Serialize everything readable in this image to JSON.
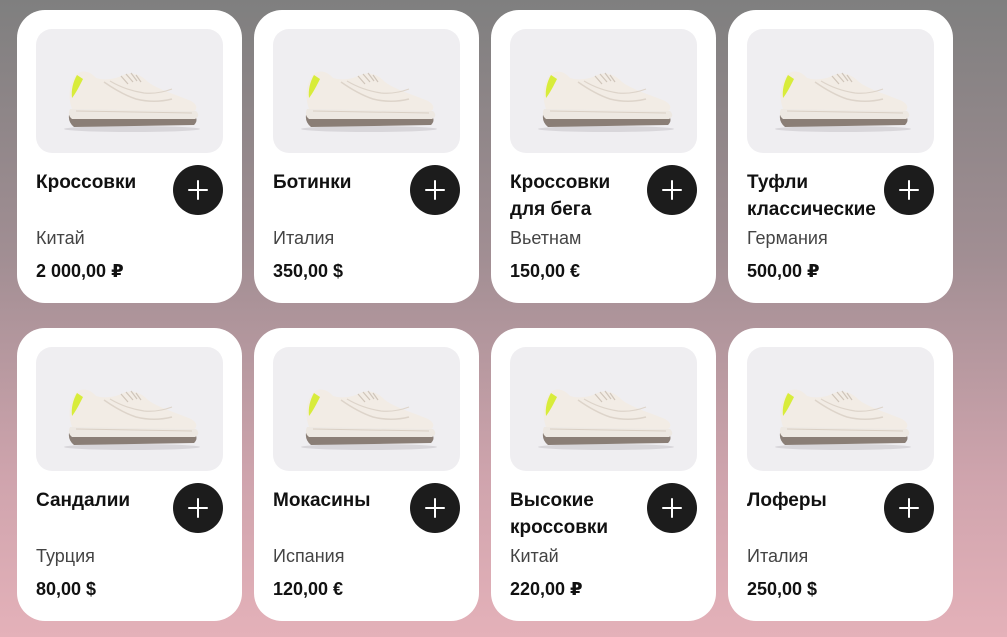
{
  "products": [
    {
      "name": "Кроссовки",
      "country": "Китай",
      "price": "2 000,00 ₽",
      "add_icon": "plus-icon"
    },
    {
      "name": "Ботинки",
      "country": "Италия",
      "price": "350,00 $",
      "add_icon": "plus-icon"
    },
    {
      "name": "Кроссовки для бега",
      "country": "Вьетнам",
      "price": "150,00 €",
      "add_icon": "plus-icon"
    },
    {
      "name": "Туфли классические",
      "country": "Германия",
      "price": "500,00 ₽",
      "add_icon": "plus-icon"
    },
    {
      "name": "Сандалии",
      "country": "Турция",
      "price": "80,00 $",
      "add_icon": "plus-icon"
    },
    {
      "name": "Мокасины",
      "country": "Испания",
      "price": "120,00 €",
      "add_icon": "plus-icon"
    },
    {
      "name": "Высокие кроссовки",
      "country": "Китай",
      "price": "220,00 ₽",
      "add_icon": "plus-icon"
    },
    {
      "name": "Лоферы",
      "country": "Италия",
      "price": "250,00 $",
      "add_icon": "plus-icon"
    }
  ],
  "colors": {
    "button": "#1c1c1c",
    "card": "#ffffff",
    "photo_bg": "#efeef1",
    "shoe_accent": "#d8ec3a"
  }
}
